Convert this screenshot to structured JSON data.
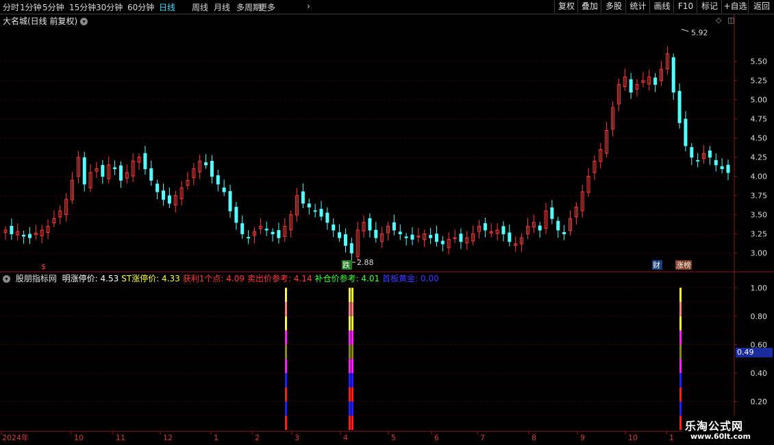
{
  "toolbar": {
    "timeframes": [
      "分时",
      "1分钟",
      "5分钟",
      "15分钟",
      "30分钟",
      "60分钟",
      "日线",
      "周线",
      "月线",
      "多周期",
      "更多"
    ],
    "active": "日线",
    "more_chevron": "chevron-right-icon",
    "buttons": [
      "复权",
      "叠加",
      "多股",
      "统计",
      "画线",
      "F10",
      "标记",
      "+自选",
      "返回"
    ]
  },
  "main": {
    "title": "大名城(日线 前复权)",
    "high_label": "5.92",
    "low_label": "2.88",
    "badges": {
      "dollar": "$",
      "drop": "跌",
      "cai": "财",
      "zhangbang": "涨榜"
    },
    "y_ticks": [
      "5.50",
      "5.25",
      "5.00",
      "4.75",
      "4.50",
      "4.25",
      "4.00",
      "3.75",
      "3.50",
      "3.25",
      "3.00"
    ]
  },
  "indicator": {
    "name": "股朋指标网",
    "fields": [
      {
        "label": "明涨停价:",
        "value": "4.53",
        "color": "#ffffff"
      },
      {
        "label": "ST涨停价:",
        "value": "4.33",
        "color": "#ffff3c"
      },
      {
        "label": "获利1个点:",
        "value": "4.09",
        "color": "#ff3c3c"
      },
      {
        "label": "卖出价参考:",
        "value": "4.14",
        "color": "#ff3c3c"
      },
      {
        "label": "补仓价参考:",
        "value": "4.01",
        "color": "#3cff3c"
      },
      {
        "label": "首板黄金:",
        "value": "0.00",
        "color": "#3c3cff"
      }
    ],
    "y_ticks": [
      "1.00",
      "0.80",
      "0.60",
      "0.40",
      "0.20"
    ],
    "current_value": "0.49"
  },
  "dates": [
    "2024年",
    "10",
    "11",
    "12",
    "1",
    "2",
    "3",
    "4",
    "5",
    "6",
    "7",
    "8",
    "9",
    "10",
    "1"
  ],
  "watermark": {
    "line1": "乐淘公式网",
    "line2": "www.60lt.com"
  },
  "colors": {
    "up": "#ff3c3c",
    "down": "#54ffff",
    "grid": "#6e0000",
    "accent": "#4fd8ff"
  },
  "chart_data": {
    "type": "candlestick",
    "series_close": [
      3.3,
      3.25,
      3.28,
      3.22,
      3.2,
      3.26,
      3.3,
      3.35,
      3.45,
      3.55,
      3.7,
      3.95,
      4.25,
      3.9,
      4.05,
      4.1,
      4.0,
      4.15,
      4.1,
      3.95,
      4.05,
      4.2,
      4.25,
      4.1,
      3.95,
      3.8,
      3.7,
      3.65,
      3.75,
      3.85,
      3.95,
      4.1,
      4.2,
      4.15,
      4.0,
      3.9,
      3.8,
      3.55,
      3.4,
      3.25,
      3.2,
      3.28,
      3.35,
      3.3,
      3.25,
      3.2,
      3.35,
      3.5,
      3.75,
      3.65,
      3.6,
      3.55,
      3.48,
      3.4,
      3.3,
      3.2,
      3.1,
      3.0,
      3.3,
      3.4,
      3.3,
      3.2,
      3.25,
      3.35,
      3.3,
      3.25,
      3.2,
      3.18,
      3.22,
      3.25,
      3.2,
      3.15,
      3.12,
      3.18,
      3.2,
      3.15,
      3.2,
      3.25,
      3.35,
      3.3,
      3.28,
      3.3,
      3.25,
      3.15,
      3.12,
      3.2,
      3.35,
      3.4,
      3.3,
      3.55,
      3.45,
      3.3,
      3.25,
      3.45,
      3.6,
      3.8,
      4.0,
      4.2,
      4.35,
      4.6,
      4.9,
      5.2,
      5.3,
      5.1,
      5.2,
      5.25,
      5.3,
      5.2,
      5.4,
      5.6,
      5.1,
      4.7,
      4.4,
      4.25,
      4.2,
      4.3,
      4.25,
      4.15,
      4.1,
      4.05
    ],
    "y_range": [
      2.88,
      5.92
    ],
    "high": 5.92,
    "low": 2.88,
    "indicator_ylim": [
      0,
      1.05
    ]
  }
}
